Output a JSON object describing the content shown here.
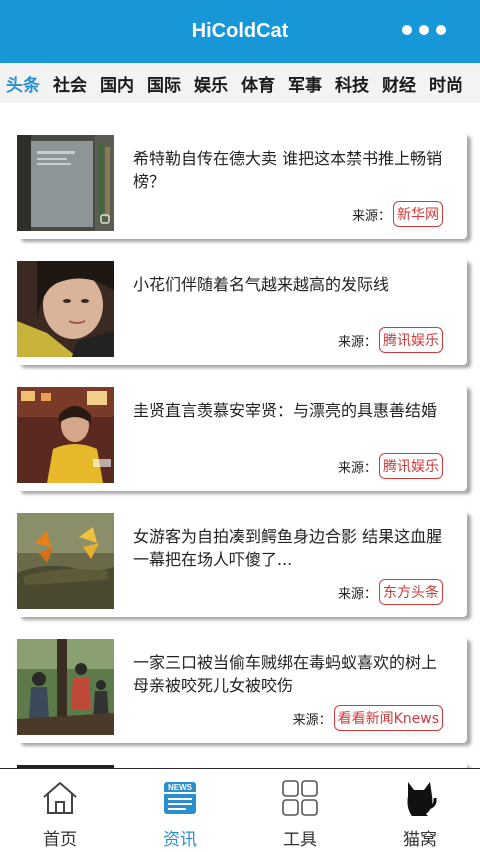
{
  "header": {
    "title": "HiColdCat",
    "more_icon": "more-dots-icon"
  },
  "tabs": [
    {
      "label": "头条",
      "active": true
    },
    {
      "label": "社会"
    },
    {
      "label": "国内"
    },
    {
      "label": "国际"
    },
    {
      "label": "娱乐"
    },
    {
      "label": "体育"
    },
    {
      "label": "军事"
    },
    {
      "label": "科技"
    },
    {
      "label": "财经"
    },
    {
      "label": "时尚"
    }
  ],
  "news": [
    {
      "title": "希特勒自传在德大卖 谁把这本禁书推上畅销榜？",
      "source_label": "来源：",
      "source": "新华网"
    },
    {
      "title": "小花们伴随着名气越来越高的发际线",
      "source_label": "来源：",
      "source": "腾讯娱乐"
    },
    {
      "title": "圭贤直言羡慕安宰贤：与漂亮的具惠善结婚",
      "source_label": "来源：",
      "source": "腾讯娱乐"
    },
    {
      "title": "女游客为自拍凑到鳄鱼身边合影 结果这血腥一幕把在场人吓傻了...",
      "source_label": "来源：",
      "source": "东方头条"
    },
    {
      "title": "一家三口被当偷车贼绑在毒蚂蚁喜欢的树上 母亲被咬死儿女被咬伤",
      "source_label": "来源：",
      "source": "看看新闻Knews"
    }
  ],
  "bottom_nav": [
    {
      "label": "首页",
      "icon": "home-icon"
    },
    {
      "label": "资讯",
      "icon": "news-icon",
      "active": true,
      "badge_text": "NEWS"
    },
    {
      "label": "工具",
      "icon": "tools-grid-icon"
    },
    {
      "label": "猫窝",
      "icon": "cat-icon"
    }
  ],
  "colors": {
    "primary": "#1796d8",
    "active_text": "#2a8fd0",
    "source_tag": "#d23a3a"
  }
}
